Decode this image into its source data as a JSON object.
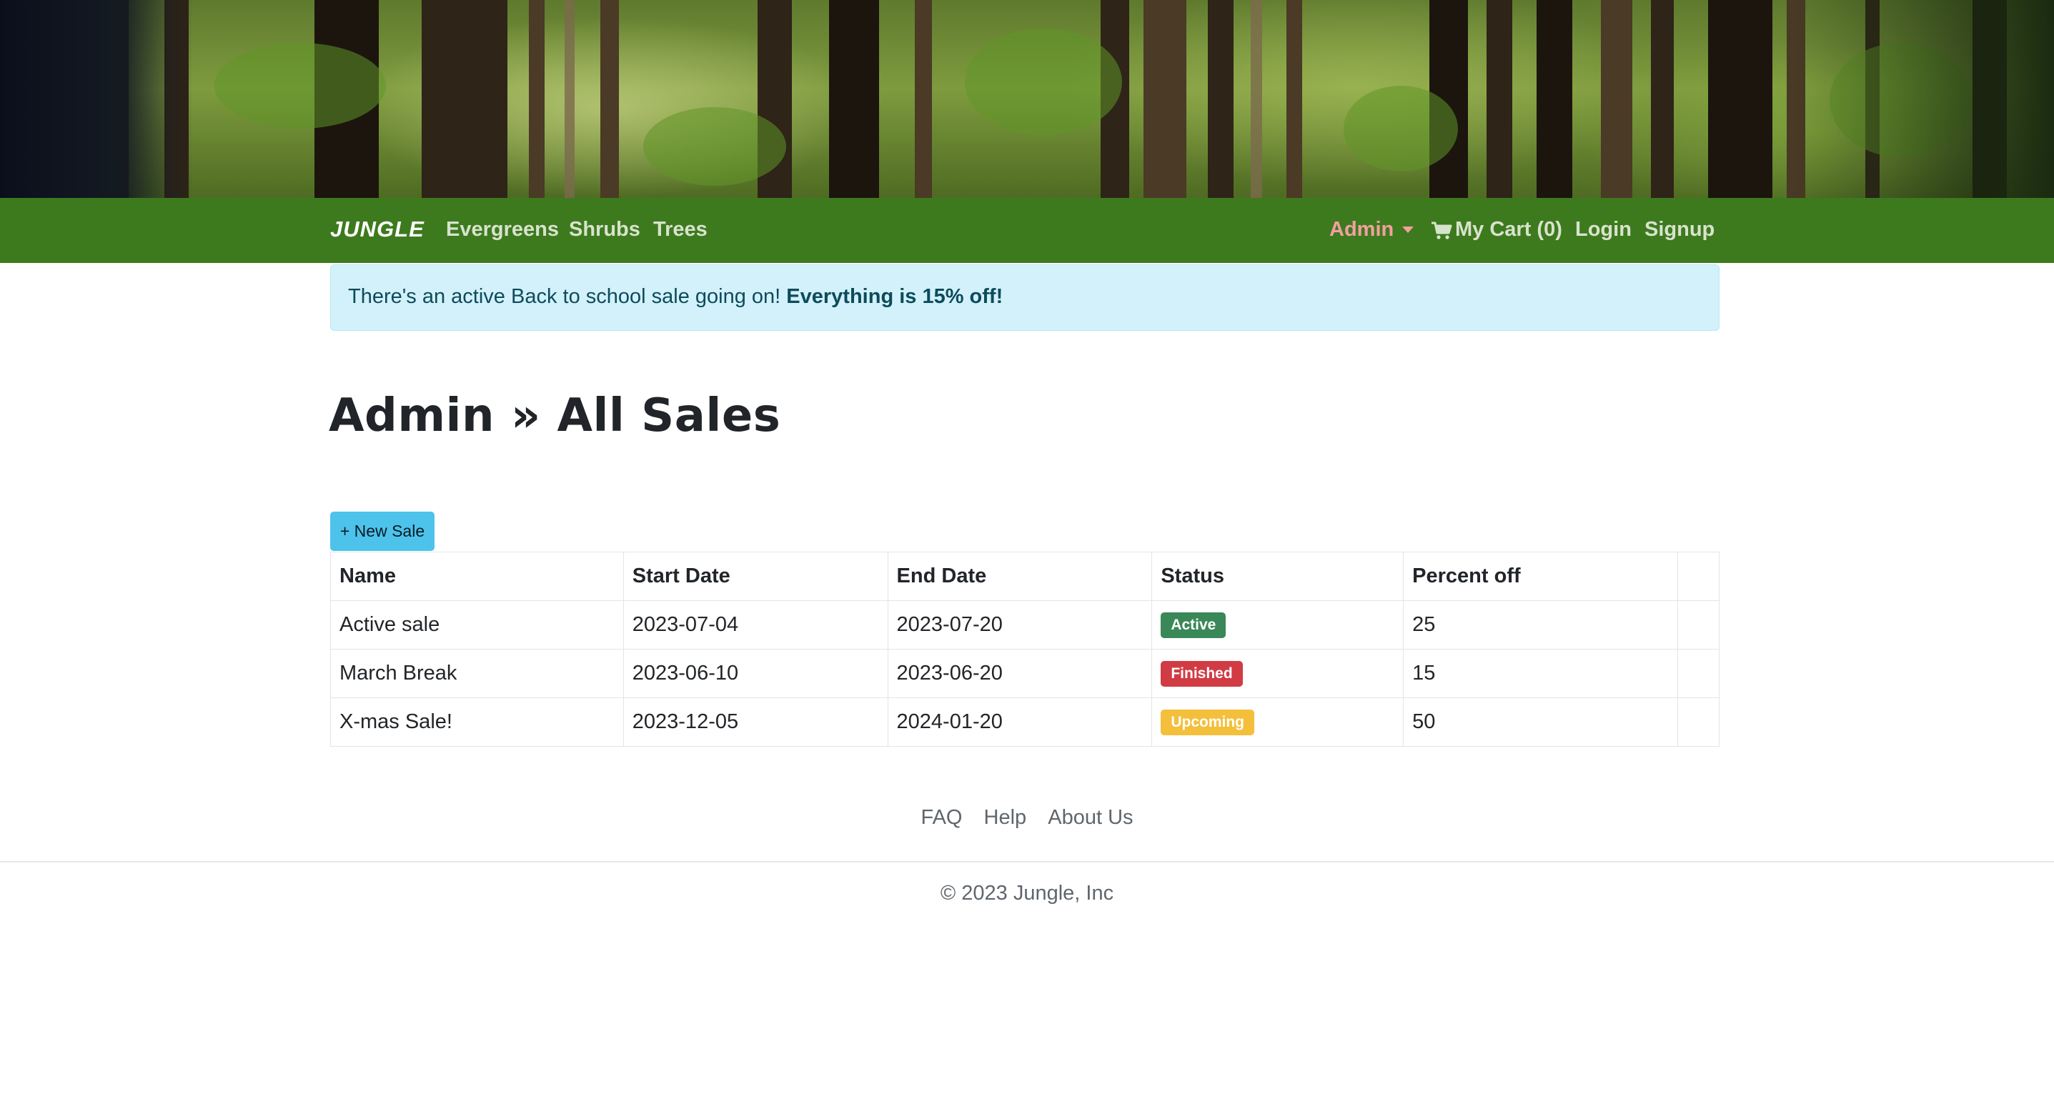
{
  "nav": {
    "brand": "JUNGLE",
    "categories": [
      "Evergreens",
      "Shrubs",
      "Trees"
    ],
    "admin_label": "Admin",
    "cart_label": "My Cart (0)",
    "login_label": "Login",
    "signup_label": "Signup"
  },
  "alert": {
    "text": "There's an active Back to school sale going on! ",
    "strong": "Everything is 15% off!"
  },
  "page": {
    "title": "Admin » All Sales",
    "new_sale_label": "+ New Sale"
  },
  "table": {
    "headers": [
      "Name",
      "Start Date",
      "End Date",
      "Status",
      "Percent off",
      ""
    ],
    "rows": [
      {
        "name": "Active sale",
        "start": "2023-07-04",
        "end": "2023-07-20",
        "status": "Active",
        "status_color": "#3a8757",
        "percent": "25"
      },
      {
        "name": "March Break",
        "start": "2023-06-10",
        "end": "2023-06-20",
        "status": "Finished",
        "status_color": "#d13b44",
        "percent": "15"
      },
      {
        "name": "X-mas Sale!",
        "start": "2023-12-05",
        "end": "2024-01-20",
        "status": "Upcoming",
        "status_color": "#f4bf3a",
        "percent": "50"
      }
    ]
  },
  "footer": {
    "links": [
      "FAQ",
      "Help",
      "About Us"
    ],
    "copyright": "© 2023 Jungle, Inc"
  },
  "colors": {
    "navbar": "#3d7a1e",
    "alert_bg": "#d3f1fa",
    "button": "#4dc3ec",
    "admin_link": "#f2a0a0"
  },
  "icons": {
    "cart": "shopping-cart-icon",
    "caret": "chevron-down-icon"
  }
}
